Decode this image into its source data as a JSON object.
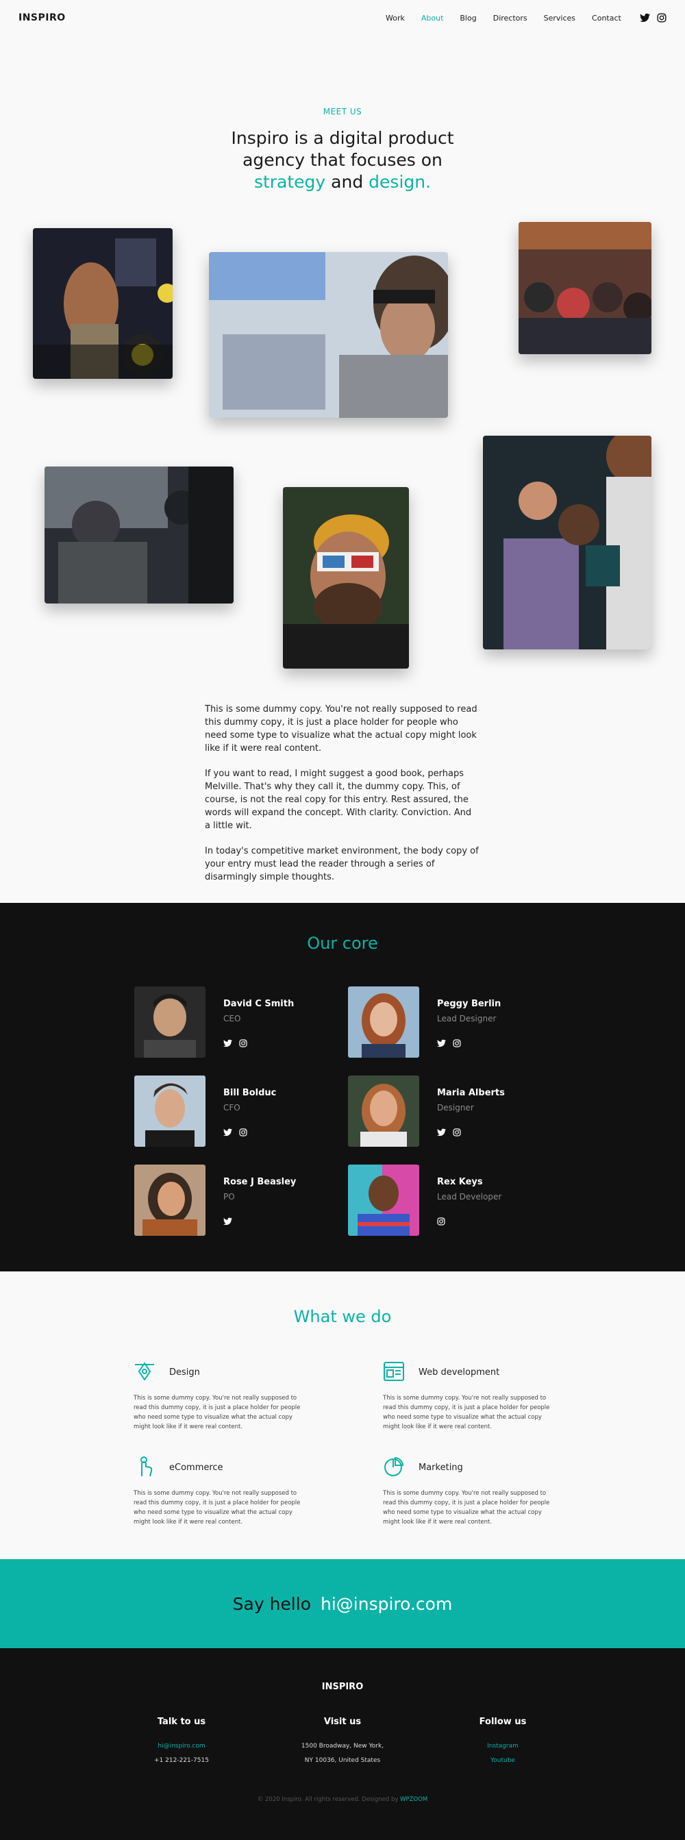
{
  "header": {
    "logo": "INSPIRO",
    "nav": [
      "Work",
      "About",
      "Blog",
      "Directors",
      "Services",
      "Contact"
    ],
    "active_nav": "About"
  },
  "hero": {
    "kicker": "MEET US",
    "title_part1": "Inspiro is a digital product agency that focuses on",
    "title_accent1": "strategy",
    "title_and": "and",
    "title_accent2": "design."
  },
  "body_copy": [
    "This is some dummy copy. You're not really supposed to read this dummy copy, it is just a place holder for people who need some type to visualize what the actual copy might look like if it were real content.",
    "If you want to read, I might suggest a good book, perhaps Melville. That's why they call it, the dummy copy. This, of course, is not the real copy for this entry. Rest assured, the words will expand the concept. With clarity. Conviction. And a little wit.",
    "In today's competitive market environment, the body copy of your entry must lead the reader through a series of disarmingly simple thoughts."
  ],
  "core": {
    "title": "Our core",
    "members": [
      {
        "name": "David C Smith",
        "role": "CEO",
        "social": [
          "twitter-icon",
          "instagram-icon"
        ]
      },
      {
        "name": "Peggy Berlin",
        "role": "Lead Designer",
        "social": [
          "twitter-icon",
          "instagram-icon"
        ]
      },
      {
        "name": "Bill Bolduc",
        "role": "CFO",
        "social": [
          "twitter-icon",
          "instagram-icon"
        ]
      },
      {
        "name": "Maria Alberts",
        "role": "Designer",
        "social": [
          "twitter-icon",
          "instagram-icon"
        ]
      },
      {
        "name": "Rose J Beasley",
        "role": "PO",
        "social": [
          "twitter-icon"
        ]
      },
      {
        "name": "Rex  Keys",
        "role": "Lead Developer",
        "social": [
          "instagram-icon"
        ]
      }
    ]
  },
  "services": {
    "title": "What we do",
    "items": [
      {
        "title": "Design",
        "icon": "pen-tool-icon",
        "text": "This is some dummy copy. You're not really supposed to read this dummy copy, it is just a place holder for people who need some type to visualize what the actual copy might look like if it were real content."
      },
      {
        "title": "Web development",
        "icon": "browser-window-icon",
        "text": "This is some dummy copy. You're not really supposed to read this dummy copy, it is just a place holder for people who need some type to visualize what the actual copy might look like if it were real content."
      },
      {
        "title": "eCommerce",
        "icon": "hand-pointer-icon",
        "text": "This is some dummy copy. You're not really supposed to read this dummy copy, it is just a place holder for people who need some type to visualize what the actual copy might look like if it were real content."
      },
      {
        "title": "Marketing",
        "icon": "pie-chart-icon",
        "text": "This is some dummy copy. You're not really supposed to read this dummy copy, it is just a place holder for people who need some type to visualize what the actual copy might look like if it were real content."
      }
    ]
  },
  "hello": {
    "label": "Say hello",
    "email": "hi@inspiro.com"
  },
  "footer": {
    "logo": "INSPIRO",
    "talk": {
      "heading": "Talk to us",
      "email": "hi@inspiro.com",
      "phone": "+1 212-221-7515"
    },
    "visit": {
      "heading": "Visit us",
      "line1": "1500 Broadway, New York,",
      "line2": "NY 10036, United States"
    },
    "follow": {
      "heading": "Follow us",
      "links": [
        "Instagram",
        "Youtube"
      ]
    },
    "copyright": "© 2020 Inspiro. All rights reserved. Designed by",
    "designer": "WPZOOM"
  },
  "colors": {
    "accent": "#0bb3a6",
    "dark": "#111111",
    "light": "#f9f9f9"
  }
}
